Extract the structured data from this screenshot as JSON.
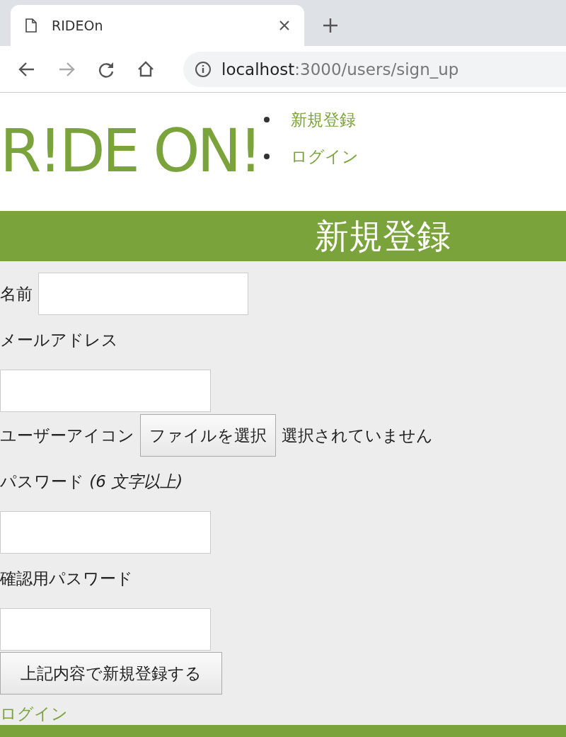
{
  "browser": {
    "tab_title": "RIDEOn",
    "url_host": "localhost",
    "url_path": ":3000/users/sign_up"
  },
  "header": {
    "logo": "R!DE ON!",
    "nav": [
      "新規登録",
      "ログイン"
    ]
  },
  "banner": {
    "title": "新規登録"
  },
  "form": {
    "fields": [
      {
        "kind": "inline",
        "label": "名前"
      },
      {
        "kind": "stacked",
        "label": "メールアドレス"
      },
      {
        "kind": "file",
        "label": "ユーザーアイコン",
        "button": "ファイルを選択",
        "status": "選択されていません"
      },
      {
        "kind": "stacked",
        "label": "パスワード *(6 文字以上)*"
      },
      {
        "kind": "stacked",
        "label": "確認用パスワード"
      }
    ],
    "submit": "上記内容で新規登録する",
    "link": "ログイン"
  }
}
